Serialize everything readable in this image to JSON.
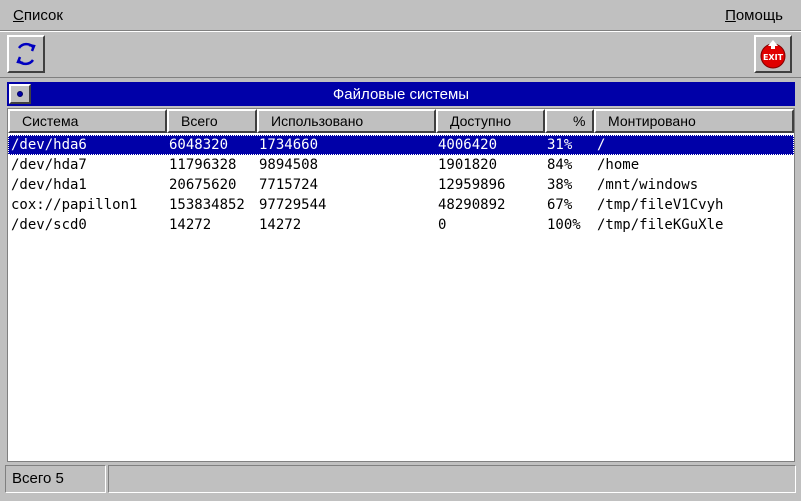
{
  "menubar": {
    "list_menu": {
      "first": "С",
      "rest": "писок"
    },
    "help_menu": {
      "first": "П",
      "rest": "омощь"
    }
  },
  "toolbar": {
    "refresh_icon": "refresh-icon",
    "exit_icon": "exit-icon",
    "exit_label": "EXIT"
  },
  "panel": {
    "title": "Файловые системы"
  },
  "columns": [
    "Система",
    "Всего",
    "Использовано",
    "Доступно",
    "%",
    "Монтировано"
  ],
  "rows": [
    [
      "/dev/hda6",
      "6048320",
      "1734660",
      "4006420",
      "31%",
      "/"
    ],
    [
      "/dev/hda7",
      "11796328",
      "9894508",
      "1901820",
      "84%",
      "/home"
    ],
    [
      "/dev/hda1",
      "20675620",
      "7715724",
      "12959896",
      "38%",
      "/mnt/windows"
    ],
    [
      "cox://papillon1",
      "153834852",
      "97729544",
      "48290892",
      "67%",
      "/tmp/fileV1Cvyh"
    ],
    [
      "/dev/scd0",
      "14272",
      "14272",
      "0",
      "100%",
      "/tmp/fileKGuXle"
    ]
  ],
  "selected_row": 0,
  "status": {
    "total": "Всего 5",
    "secondary": ""
  },
  "colors": {
    "selection": "#0000a8",
    "window_bg": "#c0c0c0",
    "exit_red": "#e00000"
  }
}
